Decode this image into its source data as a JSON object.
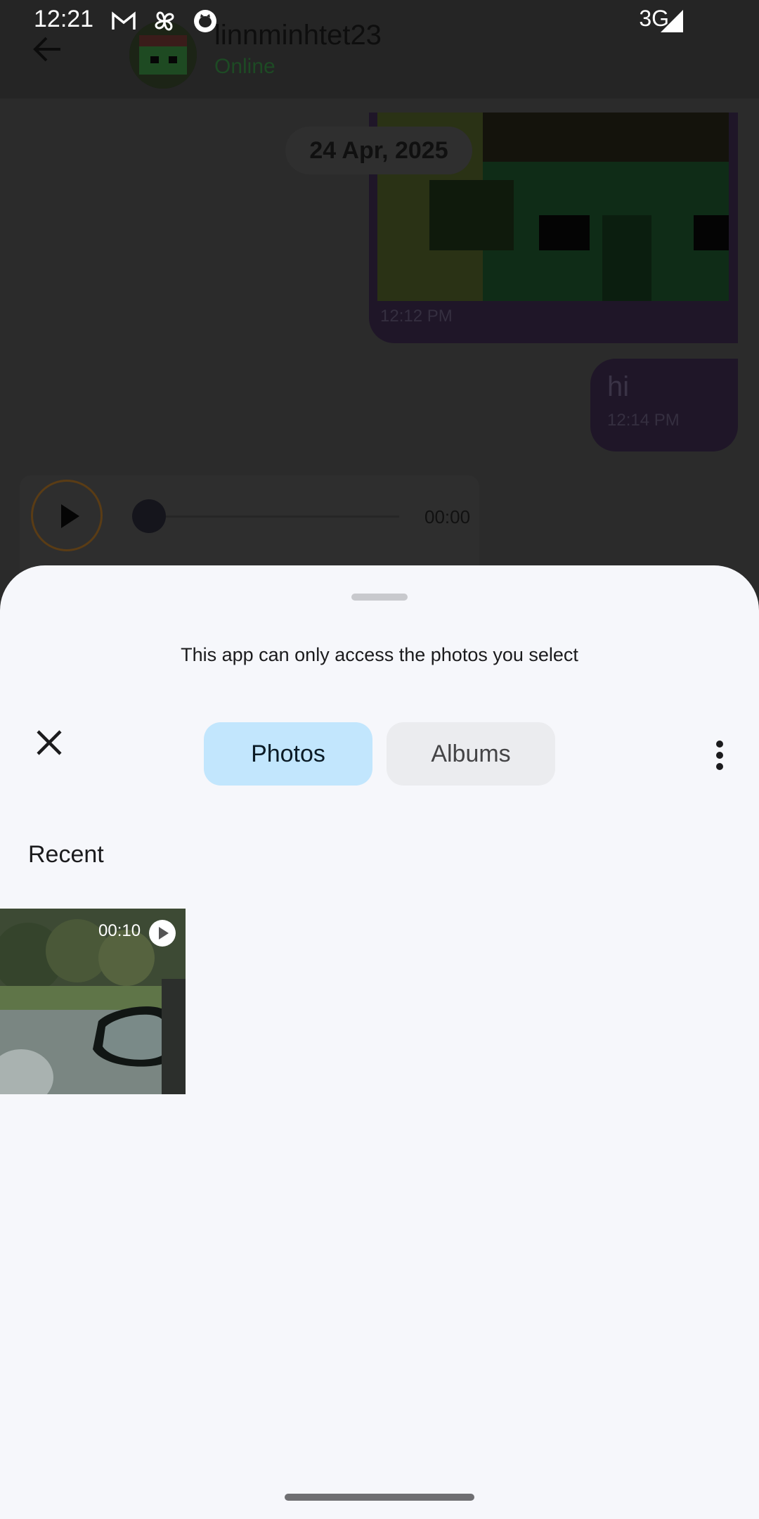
{
  "status_bar": {
    "time": "12:21",
    "network": "3G",
    "notification_icons": [
      "gmail-icon",
      "pinwheel-icon",
      "github-icon"
    ]
  },
  "chat": {
    "contact_name": "linnminhtet23",
    "contact_status": "Online",
    "date_label": "24 Apr, 2025",
    "image_message_time": "12:12 PM",
    "text_message": "hi",
    "text_message_time": "12:14 PM",
    "audio_duration": "00:00"
  },
  "sheet": {
    "access_note": "This app can only access the photos you select",
    "tabs": [
      {
        "label": "Photos",
        "selected": true
      },
      {
        "label": "Albums",
        "selected": false
      }
    ],
    "section_title": "Recent",
    "media": [
      {
        "type": "video",
        "duration": "00:10"
      }
    ]
  },
  "colors": {
    "selected_tab": "#c2e6fd",
    "sheet_bg": "#f6f7fb",
    "scrim": "#2a2a2a"
  }
}
